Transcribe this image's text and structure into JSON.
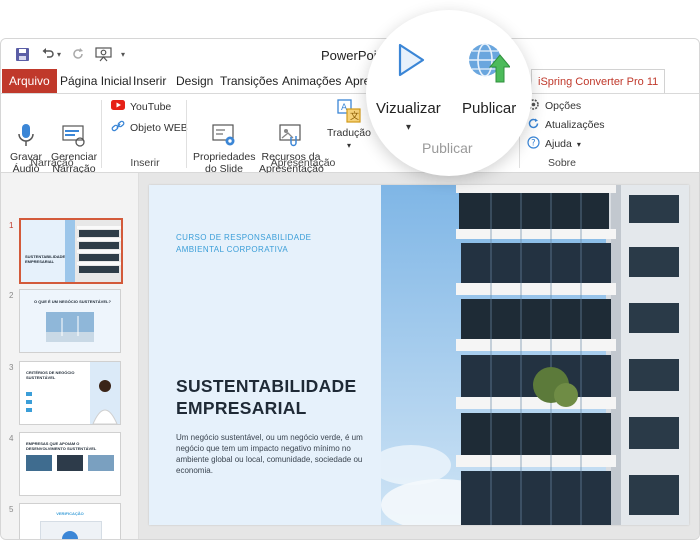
{
  "app": {
    "title": "PowerPoint"
  },
  "qat": {
    "save_icon": "save-icon",
    "undo_icon": "undo-icon",
    "redo_icon": "redo-icon",
    "present_icon": "present-icon",
    "more_icon": "chevron-down-icon"
  },
  "tabs": [
    "Arquivo",
    "Página Inicial",
    "Inserir",
    "Design",
    "Transições",
    "Animações",
    "Apre",
    "iSpring Converter Pro 11"
  ],
  "ribbon": {
    "narracao": {
      "gravar_audio": "Gravar\nÁudio",
      "gerenciar_narracao": "Gerenciar\nNarração",
      "label": "Narração"
    },
    "inserir": {
      "youtube": "YouTube",
      "objeto_web": "Objeto WEB",
      "label": "Inserir"
    },
    "apresentacao": {
      "propriedades": "Propriedades\ndo Slide",
      "recursos": "Recursos da\nApresentação",
      "traducao": "Tradução",
      "label": "Apresentação"
    },
    "sobre": {
      "opcoes": "Opções",
      "atualizacoes": "Atualizações",
      "ajuda": "Ajuda",
      "label": "Sobre"
    }
  },
  "magnifier": {
    "visualizar": "Vizualizar",
    "publicar": "Publicar",
    "group_label": "Publicar"
  },
  "slides": {
    "numbers": [
      "1",
      "2",
      "3",
      "4",
      "5"
    ],
    "thumbs": [
      {
        "title": "SUSTENTABILIDADE EMPRESARIAL"
      },
      {
        "title": "O QUE É UM NEGÓCIO SUSTENTÁVEL?"
      },
      {
        "title": "CRITÉRIOS DE NEGÓCIO SUSTENTÁVEL"
      },
      {
        "title": "EMPRESAS QUE APOIAM O DESENVOLVIMENTO SUSTENTÁVEL"
      },
      {
        "title": "VERIFICAÇÃO"
      }
    ]
  },
  "main_slide": {
    "kicker": "CURSO DE RESPONSABILIDADE AMBIENTAL CORPORATIVA",
    "title": "SUSTENTABILIDADE EMPRESARIAL",
    "body": "Um negócio sustentável, ou um negócio verde, é um negócio que tem um impacto negativo mínimo no ambiente global ou local, comunidade, sociedade ou economia."
  },
  "colors": {
    "accent": "#c0392b",
    "blue": "#3b9ed8",
    "slide_bg": "#e6f1fb"
  }
}
